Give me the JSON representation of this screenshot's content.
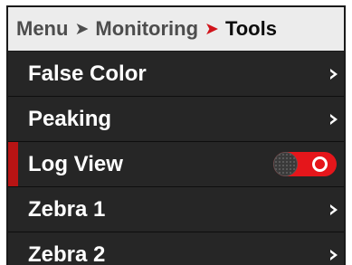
{
  "breadcrumb": {
    "root": "Menu",
    "parent": "Monitoring",
    "current": "Tools"
  },
  "menu": {
    "items": [
      {
        "label": "False Color",
        "control": "chevron"
      },
      {
        "label": "Peaking",
        "control": "chevron"
      },
      {
        "label": "Log View",
        "control": "toggle",
        "toggle_on": true,
        "active": true
      },
      {
        "label": "Zebra 1",
        "control": "chevron"
      },
      {
        "label": "Zebra 2",
        "control": "chevron"
      }
    ]
  },
  "icons": {
    "chevron": "chevron-right-icon",
    "separator": "chevron-right-icon"
  },
  "colors": {
    "accent_red": "#d1141b",
    "toggle_on": "#e5161b",
    "row_bg": "#262626",
    "header_bg": "#ececec"
  }
}
